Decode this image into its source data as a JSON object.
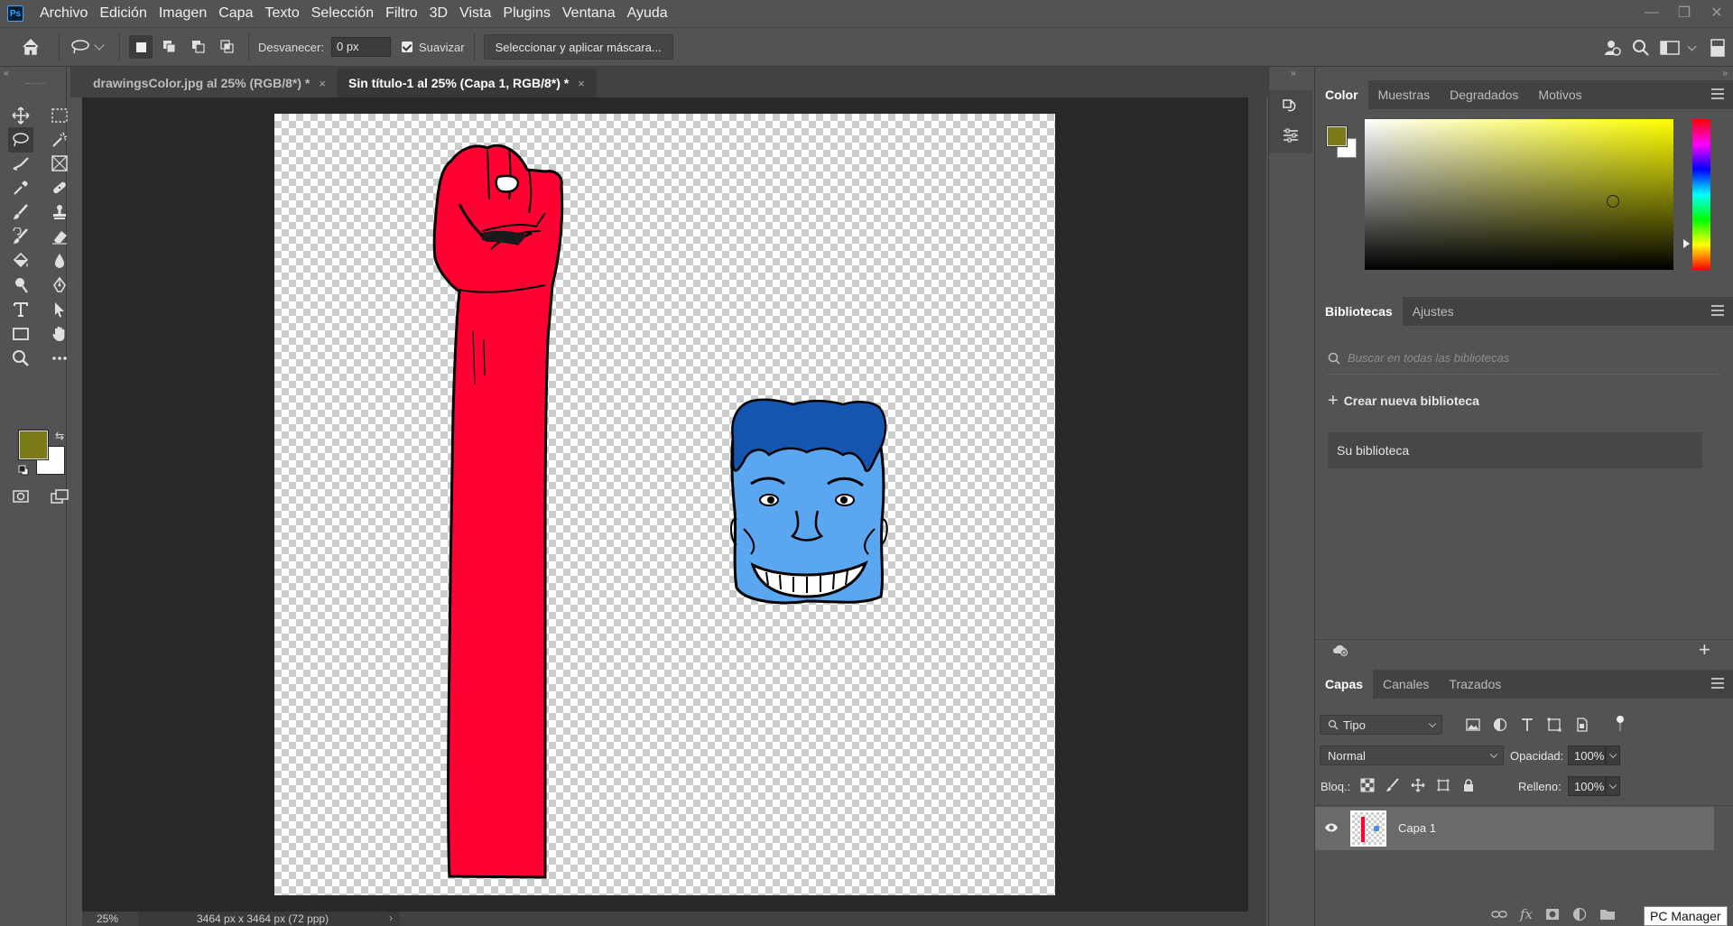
{
  "app": {
    "logo": "Ps"
  },
  "menu": [
    "Archivo",
    "Edición",
    "Imagen",
    "Capa",
    "Texto",
    "Selección",
    "Filtro",
    "3D",
    "Vista",
    "Plugins",
    "Ventana",
    "Ayuda"
  ],
  "options": {
    "feather_label": "Desvanecer:",
    "feather_value": "0 px",
    "smooth_label": "Suavizar",
    "smooth_checked": true,
    "mask_button": "Seleccionar y aplicar máscara..."
  },
  "tabs": [
    {
      "label": "drawingsColor.jpg al 25% (RGB/8*) *",
      "close": "×",
      "active": false
    },
    {
      "label": "Sin título-1 al 25% (Capa 1, RGB/8*) *",
      "close": "×",
      "active": true
    }
  ],
  "colors": {
    "foreground": "#7a7a18",
    "background": "#ffffff",
    "fist_red": "#ff0033",
    "face_light_blue": "#5aa6f0",
    "hair_blue": "#1455b0"
  },
  "status": {
    "zoom": "25%",
    "doc_size": "3464 px x 3464 px (72 ppp)",
    "arrow": "›"
  },
  "color_panel": {
    "tabs": [
      "Color",
      "Muestras",
      "Degradados",
      "Motivos"
    ],
    "active": "Color"
  },
  "libraries_panel": {
    "tabs": [
      "Bibliotecas",
      "Ajustes"
    ],
    "active": "Bibliotecas",
    "search_placeholder": "Buscar en todas las bibliotecas",
    "create_label": "Crear nueva biblioteca",
    "library_item": "Su biblioteca"
  },
  "layers_panel": {
    "tabs": [
      "Capas",
      "Canales",
      "Trazados"
    ],
    "active": "Capas",
    "filter_label": "Tipo",
    "blend_mode": "Normal",
    "opacity_label": "Opacidad:",
    "opacity_value": "100%",
    "lock_label": "Bloq.:",
    "fill_label": "Relleno:",
    "fill_value": "100%",
    "layers": [
      {
        "name": "Capa 1",
        "visible": true
      }
    ]
  },
  "taskbar_tooltip": "PC Manager"
}
